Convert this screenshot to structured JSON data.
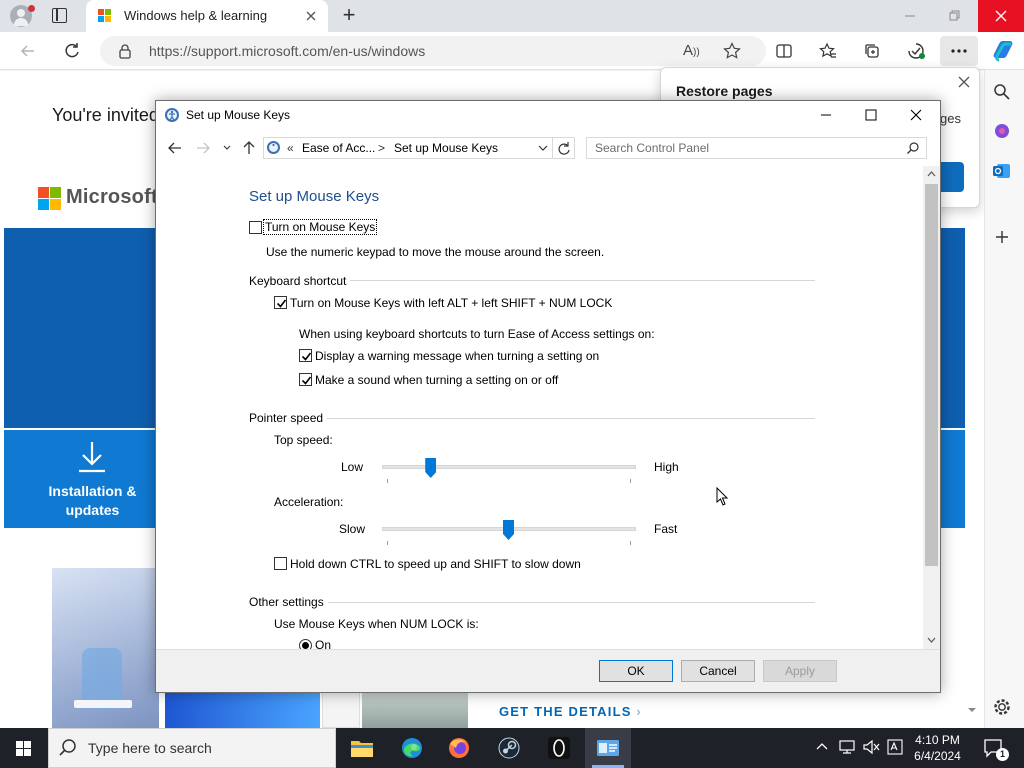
{
  "browser": {
    "tab_title": "Windows help & learning",
    "url": "https://support.microsoft.com/en-us/windows",
    "new_tab_label": "+"
  },
  "webpage": {
    "invite_text": "You're invited",
    "logo_text": "Microsoft",
    "install_tile_label": "Installation & updates",
    "get_details": "GET THE DETAILS",
    "restore_title": "Restore pages",
    "restore_body_fragment": "ges",
    "restore_button_fragment": "re"
  },
  "dialog": {
    "title": "Set up Mouse Keys",
    "breadcrumb": {
      "prefix": "«",
      "item1": "Ease of Acc...",
      "separator": ">",
      "item2": "Set up Mouse Keys"
    },
    "search_placeholder": "Search Control Panel",
    "heading": "Set up Mouse Keys",
    "turn_on": {
      "label": "Turn on Mouse Keys",
      "checked": false,
      "description": "Use the numeric keypad to move the mouse around the screen."
    },
    "keyboard_shortcut": {
      "heading": "Keyboard shortcut",
      "toggle_label": "Turn on Mouse Keys with left ALT + left SHIFT + NUM LOCK",
      "toggle_checked": true,
      "intro": "When using keyboard shortcuts to turn Ease of Access settings on:",
      "warning_label": "Display a warning message when turning a setting on",
      "warning_checked": true,
      "sound_label": "Make a sound when turning a setting on or off",
      "sound_checked": true
    },
    "pointer_speed": {
      "heading": "Pointer speed",
      "top_speed_label": "Top speed:",
      "top_speed_low": "Low",
      "top_speed_high": "High",
      "top_speed_level": 0.18,
      "acceleration_label": "Acceleration:",
      "acceleration_slow": "Slow",
      "acceleration_fast": "Fast",
      "acceleration_level": 0.5,
      "ctrl_shift_label": "Hold down CTRL to speed up and SHIFT to slow down",
      "ctrl_shift_checked": false
    },
    "other_settings": {
      "heading": "Other settings",
      "numlock_label": "Use Mouse Keys when NUM LOCK is:",
      "option_on": "On",
      "option_on_selected": true
    },
    "buttons": {
      "ok": "OK",
      "cancel": "Cancel",
      "apply": "Apply"
    }
  },
  "taskbar": {
    "search_placeholder": "Type here to search",
    "time": "4:10 PM",
    "date": "6/4/2024",
    "notification_count": "1"
  },
  "colors": {
    "accent": "#0078d7",
    "dialog_heading": "#1e4e8c",
    "hero_blue": "#0f5fb0",
    "edge_close_hover": "#e81123"
  }
}
